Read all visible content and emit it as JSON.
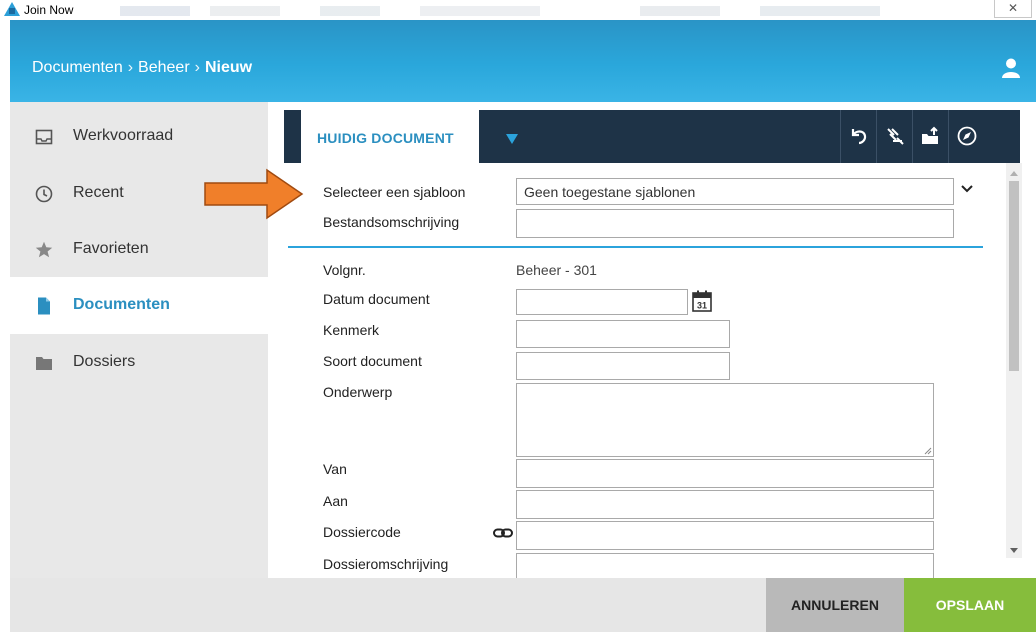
{
  "window": {
    "title": "Join Now",
    "close_glyph": "✕"
  },
  "header": {
    "breadcrumb": [
      "Documenten",
      "Beheer",
      "Nieuw"
    ],
    "user_icon": "user-icon"
  },
  "sidebar": {
    "items": [
      {
        "label": "Werkvoorraad",
        "icon": "inbox-icon",
        "active": false
      },
      {
        "label": "Recent",
        "icon": "clock-icon",
        "active": false
      },
      {
        "label": "Favorieten",
        "icon": "star-icon",
        "active": false
      },
      {
        "label": "Documenten",
        "icon": "document-icon",
        "active": true
      },
      {
        "label": "Dossiers",
        "icon": "folder-icon",
        "active": false
      }
    ]
  },
  "tabs": {
    "current_label": "HUIDIG DOCUMENT",
    "tools": [
      "undo-icon",
      "signature-icon",
      "upload-folder-icon",
      "compass-icon"
    ]
  },
  "form": {
    "template_label": "Selecteer een sjabloon",
    "template_value": "Geen toegestane sjablonen",
    "description_label": "Bestandsomschrijving",
    "description_value": "",
    "volgnr_label": "Volgnr.",
    "volgnr_value": "Beheer - 301",
    "datum_label": "Datum document",
    "datum_value": "",
    "calendar_day": "31",
    "kenmerk_label": "Kenmerk",
    "kenmerk_value": "",
    "soort_label": "Soort document",
    "soort_value": "",
    "onderwerp_label": "Onderwerp",
    "onderwerp_value": "",
    "van_label": "Van",
    "van_value": "",
    "aan_label": "Aan",
    "aan_value": "",
    "dossiercode_label": "Dossiercode",
    "dossiercode_value": "",
    "dossieromschrijving_label": "Dossieromschrijving",
    "dossieromschrijving_value": ""
  },
  "footer": {
    "cancel_label": "ANNULEREN",
    "save_label": "OPSLAAN"
  },
  "colors": {
    "header": "#2aa7db",
    "active": "#2b8fc0",
    "tabbar": "#1e3347",
    "save": "#86bd3c",
    "cancel": "#b9b9b9",
    "arrow": "#f07f2a"
  }
}
